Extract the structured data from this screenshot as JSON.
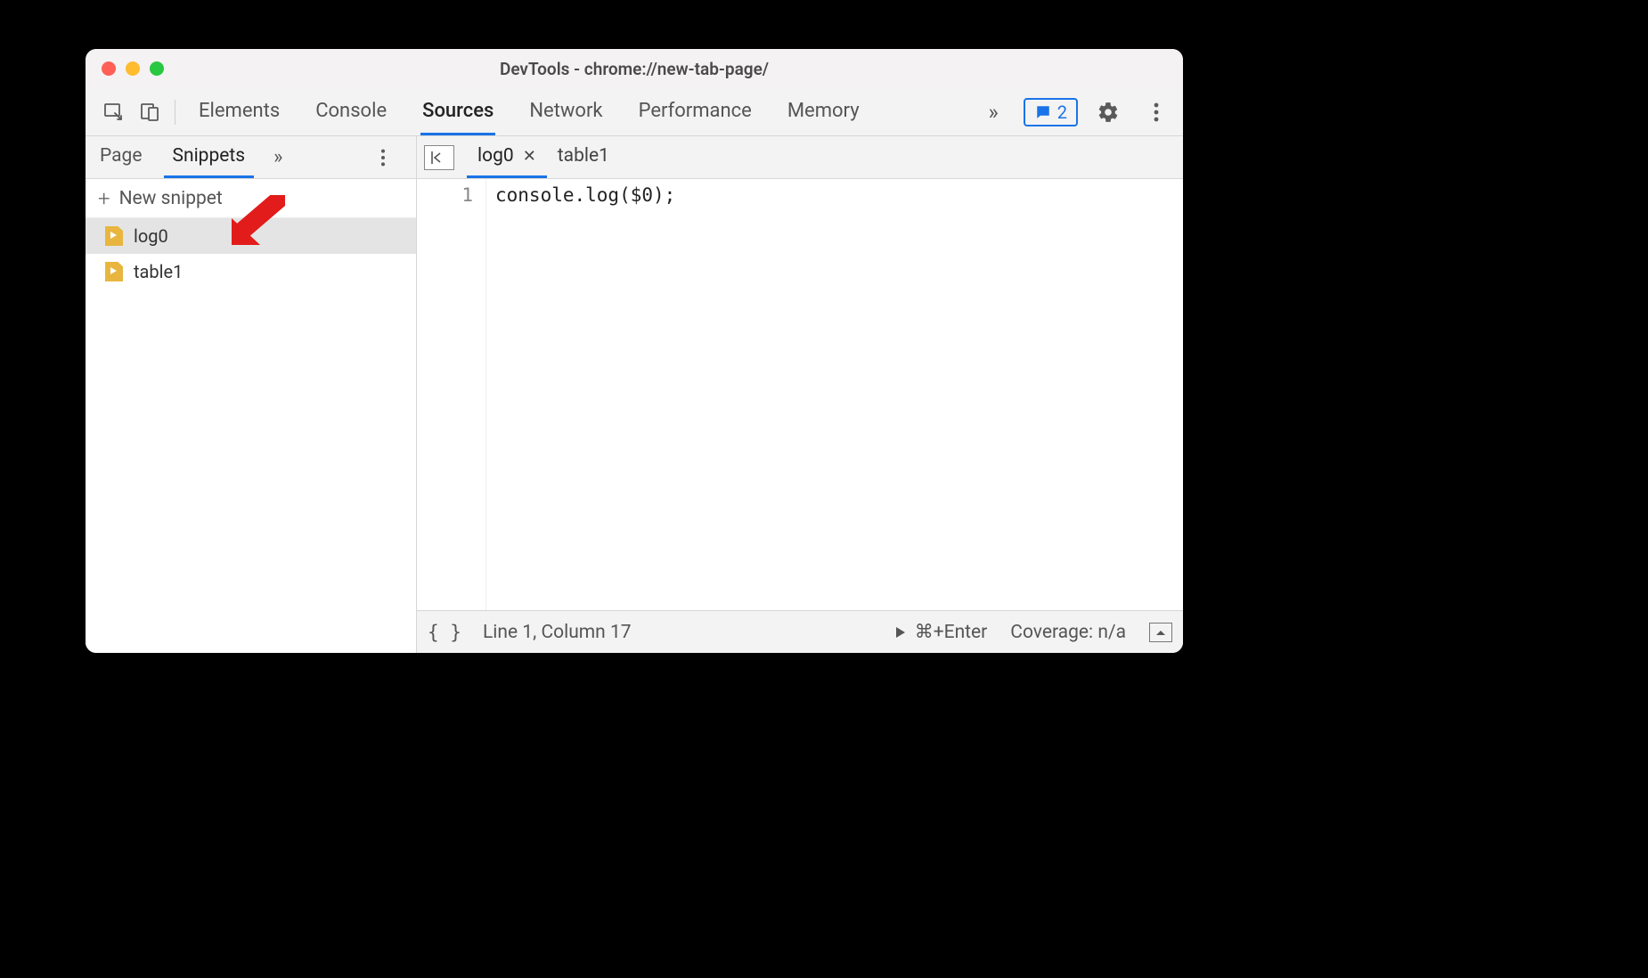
{
  "window": {
    "title": "DevTools - chrome://new-tab-page/"
  },
  "toolbar": {
    "tabs": [
      "Elements",
      "Console",
      "Sources",
      "Network",
      "Performance",
      "Memory"
    ],
    "active_tab": "Sources",
    "more_glyph": "»",
    "message_count": "2"
  },
  "sidebar": {
    "tabs": [
      "Page",
      "Snippets"
    ],
    "active_tab": "Snippets",
    "more_glyph": "»",
    "new_snippet_label": "New snippet",
    "snippets": [
      {
        "name": "log0",
        "selected": true
      },
      {
        "name": "table1",
        "selected": false
      }
    ]
  },
  "editor": {
    "open_files": [
      {
        "name": "log0",
        "active": true
      },
      {
        "name": "table1",
        "active": false
      }
    ],
    "gutter": [
      "1"
    ],
    "code_lines": [
      "console.log($0);"
    ]
  },
  "statusbar": {
    "format_glyph": "{ }",
    "cursor": "Line 1, Column 17",
    "run_shortcut": "⌘+Enter",
    "coverage": "Coverage: n/a"
  }
}
